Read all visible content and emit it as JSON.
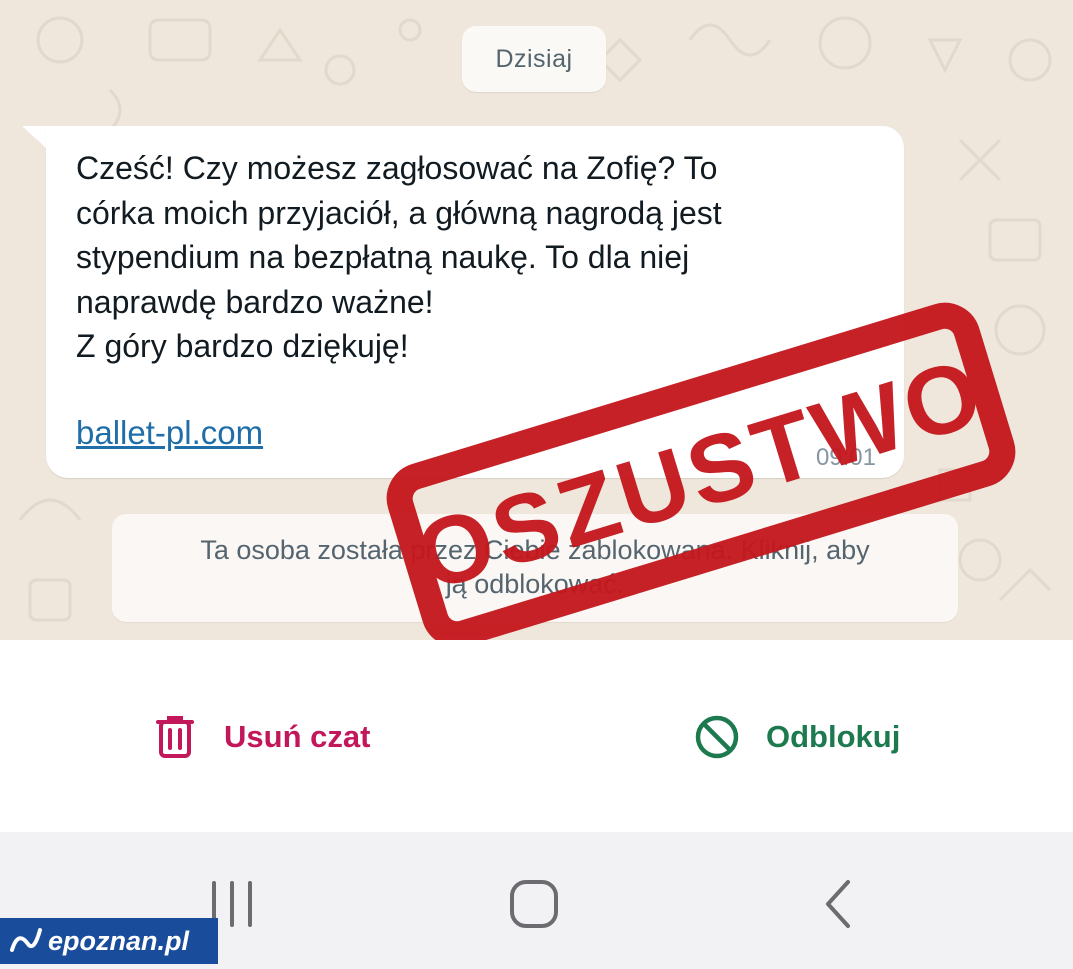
{
  "chat": {
    "date_label": "Dzisiaj",
    "message": {
      "text": "Cześć! Czy możesz zagłosować na Zofię? To\ncórka moich przyjaciół, a główną nagrodą jest\nstypendium na bezpłatną naukę. To dla niej\nnaprawdę bardzo ważne!\nZ góry bardzo dziękuję!",
      "link": "ballet-pl.com",
      "time": "09:01"
    },
    "blocked_notice_line1": "Ta osoba została przez Ciebie zablokowana. Kliknij, aby",
    "blocked_notice_line2": "ją odblokować."
  },
  "stamp": {
    "text": "OSZUSTWO",
    "color": "#c4161c"
  },
  "actions": {
    "delete_label": "Usuń czat",
    "delete_icon": "trash-icon",
    "delete_color": "#c2185b",
    "unblock_label": "Odblokuj",
    "unblock_icon": "block-icon",
    "unblock_color": "#1d7a4f"
  },
  "navbar": {
    "recents_icon": "recents-icon",
    "home_icon": "home-icon",
    "back_icon": "back-icon"
  },
  "watermark": {
    "text": "epoznan.pl",
    "color": "#1a4c9c"
  }
}
